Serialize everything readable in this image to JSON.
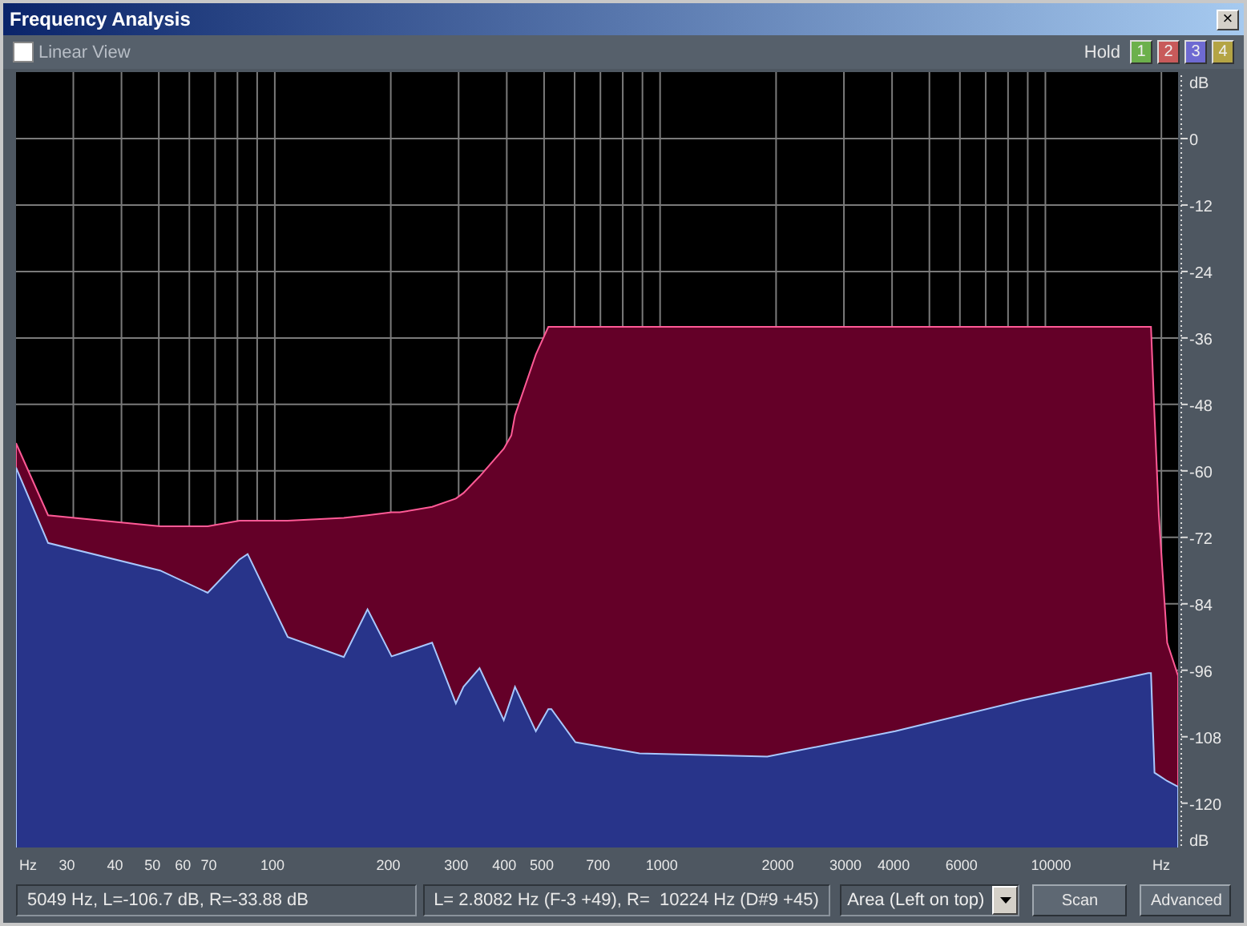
{
  "window": {
    "title": "Frequency Analysis",
    "close": "×"
  },
  "toolbar": {
    "linear_view": {
      "label": "Linear View",
      "checked": false
    },
    "hold_label": "Hold",
    "hold_buttons": [
      {
        "label": "1",
        "color": "#6cb04c"
      },
      {
        "label": "2",
        "color": "#c85a5a"
      },
      {
        "label": "3",
        "color": "#6e6ad2"
      },
      {
        "label": "4",
        "color": "#b4a444"
      }
    ]
  },
  "plot": {
    "db_labels": [
      "dB",
      "0",
      "-12",
      "-24",
      "-36",
      "-48",
      "-60",
      "-72",
      "-84",
      "-96",
      "-108",
      "-120",
      "dB"
    ],
    "hz_labels": [
      "Hz",
      "30",
      "40",
      "50",
      "60",
      "70",
      "100",
      "200",
      "300",
      "400",
      "500",
      "700",
      "1000",
      "2000",
      "3000",
      "4000",
      "6000",
      "10000",
      "Hz"
    ]
  },
  "status": {
    "cursor_readout": "5049 Hz, L=-106.7 dB, R=-33.88 dB",
    "selection_readout": "L= 2.8082 Hz (F-3 +49), R=  10224 Hz (D#9 +45)",
    "display_mode": "Area (Left on top)",
    "buttons": [
      "Scan",
      "Advanced"
    ]
  }
}
